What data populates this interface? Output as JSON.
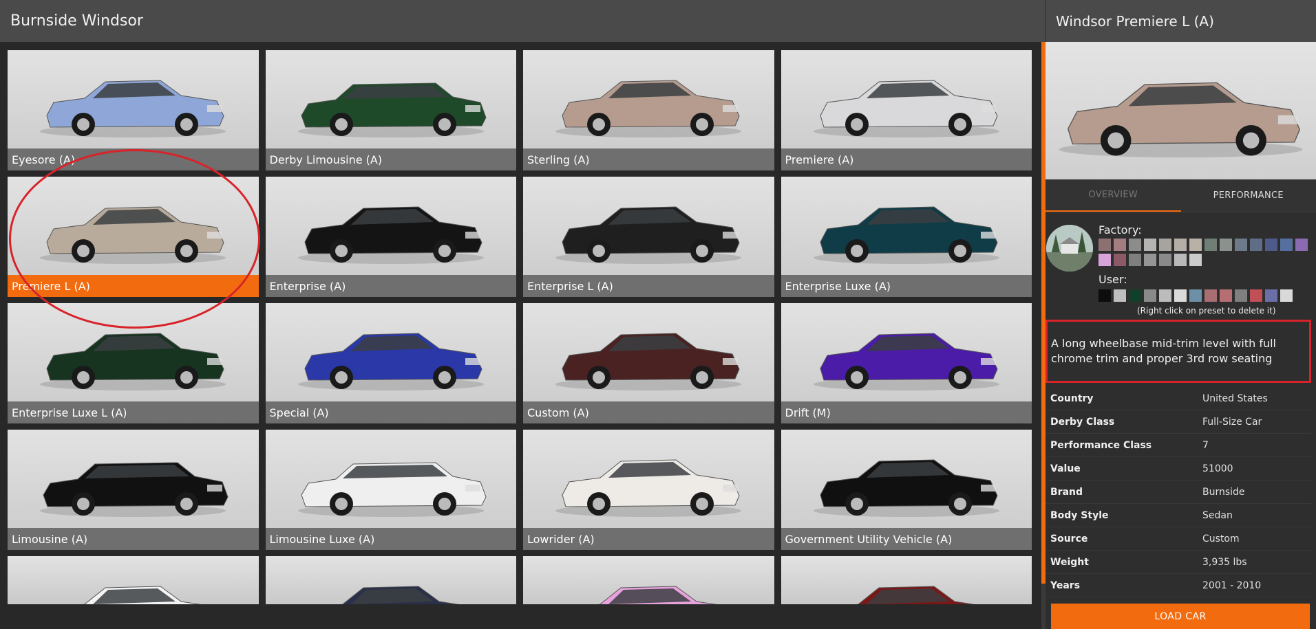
{
  "browser": {
    "title": "Burnside Windsor"
  },
  "tiles": [
    {
      "label": "Eyesore (A)",
      "color": "#8fa7d8",
      "selected": false
    },
    {
      "label": "Derby Limousine (A)",
      "color": "#1f4a2a",
      "selected": false
    },
    {
      "label": "Sterling (A)",
      "color": "#b59c8e",
      "selected": false
    },
    {
      "label": "Premiere (A)",
      "color": "#d9d9db",
      "selected": false
    },
    {
      "label": "Premiere L (A)",
      "color": "#b9ab9c",
      "selected": true
    },
    {
      "label": "Enterprise (A)",
      "color": "#141414",
      "selected": false
    },
    {
      "label": "Enterprise L (A)",
      "color": "#1f1f1f",
      "selected": false
    },
    {
      "label": "Enterprise Luxe (A)",
      "color": "#103c48",
      "selected": false
    },
    {
      "label": "Enterprise Luxe L (A)",
      "color": "#16341f",
      "selected": false
    },
    {
      "label": "Special (A)",
      "color": "#2a38a8",
      "selected": false
    },
    {
      "label": "Custom (A)",
      "color": "#4a2222",
      "selected": false
    },
    {
      "label": "Drift (M)",
      "color": "#4b1ca8",
      "selected": false
    },
    {
      "label": "Limousine (A)",
      "color": "#111111",
      "selected": false
    },
    {
      "label": "Limousine Luxe (A)",
      "color": "#efefef",
      "selected": false
    },
    {
      "label": "Lowrider (A)",
      "color": "#eeeae6",
      "selected": false
    },
    {
      "label": "Government Utility Vehicle (A)",
      "color": "#101010",
      "selected": false
    },
    {
      "label": "",
      "color": "#f4f4f4",
      "selected": false
    },
    {
      "label": "",
      "color": "#2a2f4a",
      "selected": false
    },
    {
      "label": "",
      "color": "#e8a2dd",
      "selected": false
    },
    {
      "label": "",
      "color": "#7a1818",
      "selected": false
    }
  ],
  "detail": {
    "title": "Windsor Premiere L (A)",
    "tabs": {
      "overview": "OVERVIEW",
      "performance": "PERFORMANCE"
    },
    "factory_label": "Factory:",
    "user_label": "User:",
    "factory_swatches": [
      "#8d7071",
      "#a37d80",
      "#8c8c8c",
      "#b6b4b2",
      "#a7a39f",
      "#b5aea6",
      "#b9b1a5",
      "#6f7f76",
      "#8b918d",
      "#6c7a8a",
      "#5f6d87",
      "#4e5a8a",
      "#556f9f",
      "#8a6ab0",
      "#d8a3d8",
      "#8b5a64",
      "#7f7f7f",
      "#959595",
      "#8a8a8a",
      "#b9b9b9",
      "#cbcbcb"
    ],
    "user_swatches": [
      "#0d0d0d",
      "#bfbfbf",
      "#123f2a",
      "#8a8a8a",
      "#bcbcbc",
      "#dadada",
      "#6e8fa8",
      "#a86e72",
      "#b56f72",
      "#7f7f7f",
      "#c05055",
      "#6a6fa8",
      "#d9d9d9"
    ],
    "hint": "(Right click on preset to delete it)",
    "description": "A long wheelbase mid-trim level with full chrome trim and proper 3rd row seating",
    "info": [
      {
        "key": "Country",
        "value": "United States"
      },
      {
        "key": "Derby Class",
        "value": "Full-Size Car"
      },
      {
        "key": "Performance Class",
        "value": "7"
      },
      {
        "key": "Value",
        "value": "51000"
      },
      {
        "key": "Brand",
        "value": "Burnside"
      },
      {
        "key": "Body Style",
        "value": "Sedan"
      },
      {
        "key": "Source",
        "value": "Custom"
      },
      {
        "key": "Weight",
        "value": "3,935 lbs"
      },
      {
        "key": "Years",
        "value": "2001 - 2010"
      }
    ],
    "load_button": "LOAD CAR",
    "preview_color": "#b59c8e"
  },
  "colors": {
    "accent": "#f26b0f",
    "highlight": "#d8232a"
  }
}
